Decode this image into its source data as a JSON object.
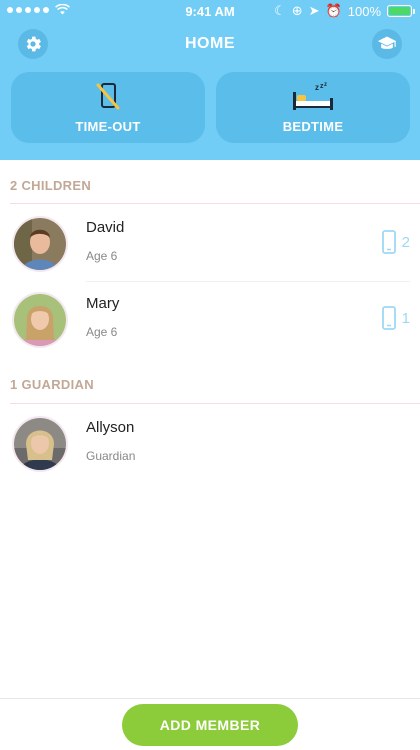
{
  "status_bar": {
    "time": "9:41 AM",
    "battery_percent": "100%",
    "battery_level": 1.0,
    "signal_bars": 5
  },
  "nav": {
    "title": "HOME",
    "left_icon": "gear-icon",
    "right_icon": "graduation-cap-icon"
  },
  "modes": [
    {
      "label": "TIME-OUT",
      "icon": "phone-disabled-icon"
    },
    {
      "label": "BEDTIME",
      "icon": "bed-icon"
    }
  ],
  "sections": {
    "children_header": "2 CHILDREN",
    "guardians_header": "1 GUARDIAN"
  },
  "children": [
    {
      "name": "David",
      "sub": "Age 6",
      "device_count": "2"
    },
    {
      "name": "Mary",
      "sub": "Age 6",
      "device_count": "1"
    }
  ],
  "guardians": [
    {
      "name": "Allyson",
      "sub": "Guardian"
    }
  ],
  "footer": {
    "add_member_label": "ADD MEMBER"
  },
  "colors": {
    "header_blue": "#71cdf6",
    "card_blue": "#5bbdea",
    "accent_green": "#8ccc3a",
    "section_text": "#c2a896"
  }
}
